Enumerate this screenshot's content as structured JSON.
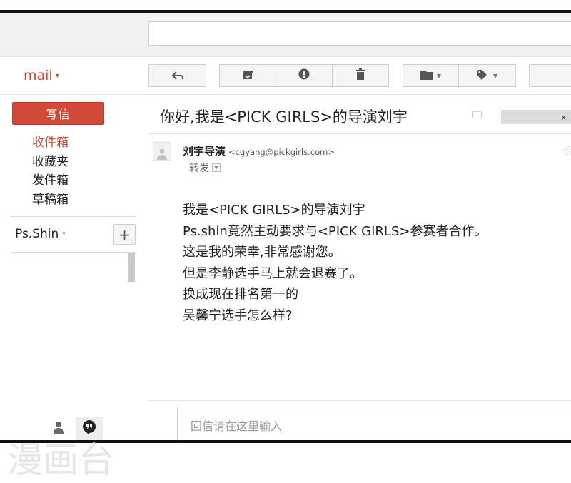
{
  "header": {
    "search_value": ""
  },
  "brand": {
    "label": "mail",
    "caret": "▾",
    "color": "#d14836"
  },
  "toolbar": {
    "icons": [
      "reply-icon",
      "archive-icon",
      "report-spam-icon",
      "trash-icon",
      "folder-icon",
      "tag-icon"
    ]
  },
  "sidebar": {
    "compose_label": "写信",
    "items": [
      {
        "label": "收件箱",
        "active": true
      },
      {
        "label": "收藏夹",
        "active": false
      },
      {
        "label": "发件箱",
        "active": false
      },
      {
        "label": "草稿箱",
        "active": false
      }
    ],
    "account": {
      "label": "Ps.Shin",
      "caret": "▾"
    },
    "add_label": "+"
  },
  "message": {
    "subject": "你好,我是<PICK GIRLS>的导演刘宇",
    "tag_close": "x",
    "sender_name": "刘宇导演",
    "sender_email": "<cgyang@pickgirls.com>",
    "to_label": "转发",
    "body": [
      "我是<PICK GIRLS>的导演刘宇",
      "Ps.shin竟然主动要求与<PICK GIRLS>参赛者合作。",
      "这是我的荣幸,非常感谢您。",
      "但是李静选手马上就会退赛了。",
      "换成现在排名第一的",
      "吴馨宁选手怎么样?"
    ]
  },
  "reply": {
    "placeholder": "回信请在这里输入"
  },
  "watermark": {
    "text": "漫画台"
  }
}
